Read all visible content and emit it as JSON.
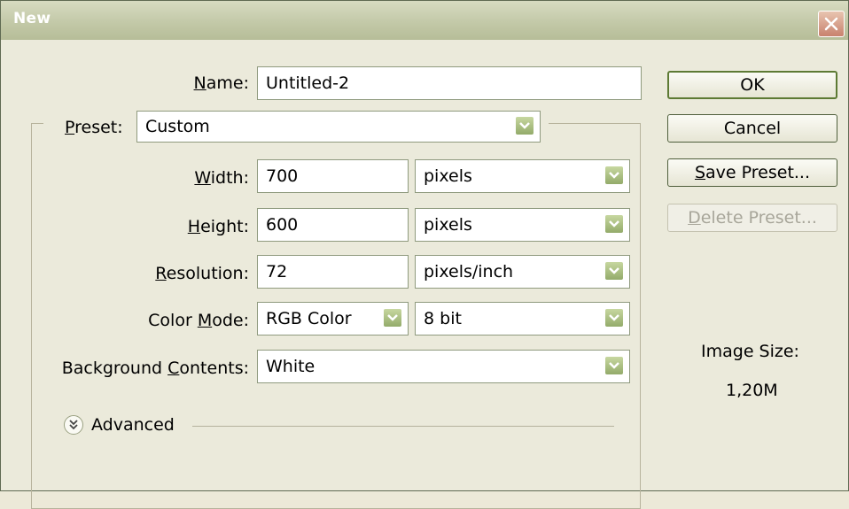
{
  "window": {
    "title": "New",
    "close_icon": "close-icon"
  },
  "form": {
    "name": {
      "label_pre": "",
      "label_key": "N",
      "label_post": "ame:",
      "value": "Untitled-2"
    },
    "preset": {
      "label_key": "P",
      "label_post": "reset:",
      "value": "Custom"
    },
    "width": {
      "label_key": "W",
      "label_post": "idth:",
      "value": "700",
      "unit": "pixels"
    },
    "height": {
      "label_key": "H",
      "label_post": "eight:",
      "value": "600",
      "unit": "pixels"
    },
    "resolution": {
      "label_key": "R",
      "label_post": "esolution:",
      "value": "72",
      "unit": "pixels/inch"
    },
    "color_mode": {
      "label_pre": "Color ",
      "label_key": "M",
      "label_post": "ode:",
      "value": "RGB Color",
      "depth": "8 bit"
    },
    "background": {
      "label_pre": "Background ",
      "label_key": "C",
      "label_post": "ontents:",
      "value": "White"
    },
    "advanced": {
      "label": "Advanced",
      "icon": "chevron-double-down-icon"
    }
  },
  "buttons": {
    "ok": "OK",
    "cancel": "Cancel",
    "save_preset_key": "S",
    "save_preset_post": "ave Preset...",
    "delete_preset_key": "D",
    "delete_preset_post": "elete Preset..."
  },
  "image_size": {
    "label": "Image Size:",
    "value": "1,20M"
  },
  "colors": {
    "accent": "#93ab6a",
    "window_bg": "#ebeadb",
    "titlebar": "#c3c9a8"
  }
}
